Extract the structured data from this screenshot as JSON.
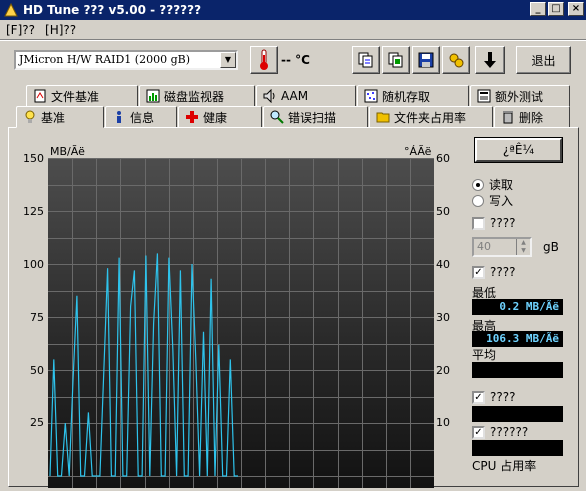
{
  "window": {
    "title": "HD Tune ??? v5.00 - ??????",
    "controls": [
      "_",
      "□",
      "×"
    ]
  },
  "menu": [
    "[F]??",
    "[H]??"
  ],
  "toolbar": {
    "drive": "JMicron H/W RAID1 (2000 gB)",
    "temperature": "-- °C",
    "exit_label": "退出",
    "icons": [
      "copy-icon",
      "copy-info-icon",
      "save-icon",
      "options-icon",
      "download-icon"
    ]
  },
  "tabs_top": [
    {
      "label": "文件基准",
      "icon": "file-benchmark-icon"
    },
    {
      "label": "磁盘监视器",
      "icon": "disk-monitor-icon"
    },
    {
      "label": "AAM",
      "icon": "speaker-icon"
    },
    {
      "label": "随机存取",
      "icon": "random-access-icon"
    },
    {
      "label": "额外测试",
      "icon": "extra-tests-icon"
    }
  ],
  "tabs_bottom": [
    {
      "label": "基准",
      "icon": "lightbulb-icon",
      "active": true
    },
    {
      "label": "信息",
      "icon": "info-icon"
    },
    {
      "label": "健康",
      "icon": "health-cross-icon"
    },
    {
      "label": "错误扫描",
      "icon": "magnifier-icon"
    },
    {
      "label": "文件夹占用率",
      "icon": "folder-icon"
    },
    {
      "label": "删除",
      "icon": "trash-icon"
    }
  ],
  "chart": {
    "left_unit": "MB/Ãë",
    "right_unit": "°ÁÃë",
    "left_ticks": [
      "150",
      "125",
      "100",
      "75",
      "50",
      "25"
    ],
    "right_ticks": [
      "60",
      "50",
      "40",
      "30",
      "20",
      "10"
    ]
  },
  "chart_data": {
    "type": "line",
    "ylabel": "MB/Ãë",
    "ylim": [
      0,
      150
    ],
    "y2label": "°ÁÃë",
    "y2lim": [
      0,
      60
    ],
    "grid": true,
    "series": [
      {
        "color": "#2ec3ec",
        "values": [
          0,
          55,
          0,
          0,
          25,
          0,
          45,
          85,
          0,
          0,
          30,
          0,
          0,
          0,
          48,
          98,
          0,
          0,
          103,
          0,
          0,
          80,
          97,
          0,
          0,
          104,
          0,
          72,
          105,
          0,
          0,
          103,
          60,
          0,
          97,
          0,
          0,
          100,
          55,
          0,
          68,
          0,
          93,
          0,
          62,
          0,
          0,
          55,
          0,
          0
        ]
      }
    ]
  },
  "side": {
    "start_label": "¿ªÊ¼",
    "read_label": "读取",
    "write_label": "写入",
    "check1_label": "????",
    "size_value": "40",
    "size_unit": "gB",
    "check2_label": "????",
    "min_label": "最低",
    "min_value": "0.2 MB/Ãë",
    "max_label": "最高",
    "max_value": "106.3 MB/Ãë",
    "avg_label": "平均",
    "check3_label": "????",
    "check4_label": "??????",
    "cpu_label": "CPU 占用率"
  }
}
